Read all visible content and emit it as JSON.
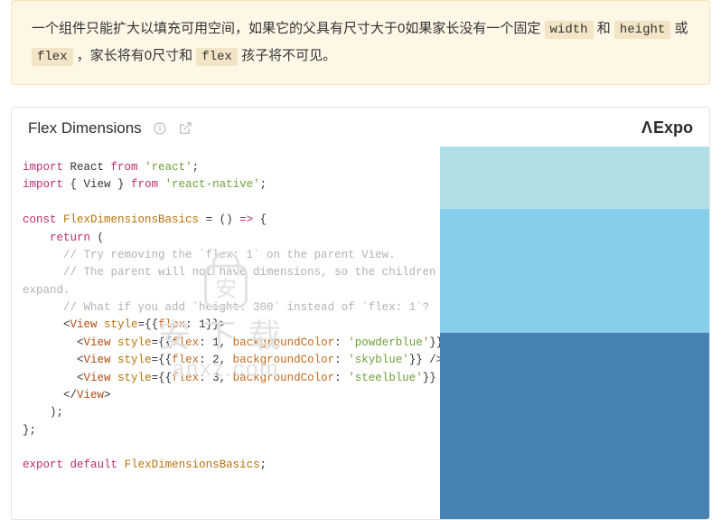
{
  "callout": {
    "seg1": "一个组件只能扩大以填充可用空间，如果它的父具有尺寸大于0如果家长没有一个固定 ",
    "code1": "width",
    "seg2": " 和 ",
    "code2": "height",
    "seg3": " 或 ",
    "code3": "flex",
    "seg4": " ，家长将有0尺寸和 ",
    "code4": "flex",
    "seg5": " 孩子将不可见。"
  },
  "panel": {
    "title": "Flex Dimensions",
    "brand": "Expo"
  },
  "code": {
    "lines": [
      {
        "t": "import",
        "kw": true
      },
      {
        "t": " React "
      },
      {
        "t": "from",
        "kw": true
      },
      {
        "t": " "
      },
      {
        "t": "'react'",
        "str": true
      },
      {
        "t": ";"
      },
      {
        "nl": true
      },
      {
        "t": "import",
        "kw": true
      },
      {
        "t": " { View } "
      },
      {
        "t": "from",
        "kw": true
      },
      {
        "t": " "
      },
      {
        "t": "'react-native'",
        "str": true
      },
      {
        "t": ";"
      },
      {
        "nl": true
      },
      {
        "nl": true
      },
      {
        "t": "const",
        "kw": true
      },
      {
        "t": " "
      },
      {
        "t": "FlexDimensionsBasics",
        "var": true
      },
      {
        "t": " = () "
      },
      {
        "t": "=>",
        "kw": true
      },
      {
        "t": " {"
      },
      {
        "nl": true
      },
      {
        "t": "    "
      },
      {
        "t": "return",
        "kw": true
      },
      {
        "t": " ("
      },
      {
        "nl": true
      },
      {
        "t": "      "
      },
      {
        "t": "// Try removing the `flex: 1` on the parent View.",
        "cmt": true
      },
      {
        "nl": true
      },
      {
        "t": "      "
      },
      {
        "t": "// The parent will not have dimensions, so the children can't",
        "cmt": true
      },
      {
        "nl": true
      },
      {
        "t": "expand.",
        "cmt": true
      },
      {
        "nl": true
      },
      {
        "t": "      "
      },
      {
        "t": "// What if you add `height: 300` instead of `flex: 1`?",
        "cmt": true
      },
      {
        "nl": true
      },
      {
        "t": "      <"
      },
      {
        "t": "View",
        "jsx": true
      },
      {
        "t": " "
      },
      {
        "t": "style",
        "attr": true
      },
      {
        "t": "="
      },
      {
        "t": "{{"
      },
      {
        "t": "flex",
        "prop": true
      },
      {
        "t": ": "
      },
      {
        "t": "1",
        "num": true
      },
      {
        "t": "}}"
      },
      {
        "t": ">"
      },
      {
        "nl": true
      },
      {
        "t": "        <"
      },
      {
        "t": "View",
        "jsx": true
      },
      {
        "t": " "
      },
      {
        "t": "style",
        "attr": true
      },
      {
        "t": "="
      },
      {
        "t": "{{"
      },
      {
        "t": "flex",
        "prop": true
      },
      {
        "t": ": "
      },
      {
        "t": "1",
        "num": true
      },
      {
        "t": ", "
      },
      {
        "t": "backgroundColor",
        "prop": true
      },
      {
        "t": ": "
      },
      {
        "t": "'powderblue'",
        "str": true
      },
      {
        "t": "}} />"
      },
      {
        "nl": true
      },
      {
        "t": "        <"
      },
      {
        "t": "View",
        "jsx": true
      },
      {
        "t": " "
      },
      {
        "t": "style",
        "attr": true
      },
      {
        "t": "="
      },
      {
        "t": "{{"
      },
      {
        "t": "flex",
        "prop": true
      },
      {
        "t": ": "
      },
      {
        "t": "2",
        "num": true
      },
      {
        "t": ", "
      },
      {
        "t": "backgroundColor",
        "prop": true
      },
      {
        "t": ": "
      },
      {
        "t": "'skyblue'",
        "str": true
      },
      {
        "t": "}} />"
      },
      {
        "nl": true
      },
      {
        "t": "        <"
      },
      {
        "t": "View",
        "jsx": true
      },
      {
        "t": " "
      },
      {
        "t": "style",
        "attr": true
      },
      {
        "t": "="
      },
      {
        "t": "{{"
      },
      {
        "t": "flex",
        "prop": true
      },
      {
        "t": ": "
      },
      {
        "t": "3",
        "num": true
      },
      {
        "t": ", "
      },
      {
        "t": "backgroundColor",
        "prop": true
      },
      {
        "t": ": "
      },
      {
        "t": "'steelblue'",
        "str": true
      },
      {
        "t": "}} />"
      },
      {
        "nl": true
      },
      {
        "t": "      </"
      },
      {
        "t": "View",
        "jsx": true
      },
      {
        "t": ">"
      },
      {
        "nl": true
      },
      {
        "t": "    );"
      },
      {
        "nl": true
      },
      {
        "t": "};"
      },
      {
        "nl": true
      },
      {
        "nl": true
      },
      {
        "t": "export",
        "kw": true
      },
      {
        "t": " "
      },
      {
        "t": "default",
        "kw": true
      },
      {
        "t": " "
      },
      {
        "t": "FlexDimensionsBasics",
        "var": true
      },
      {
        "t": ";"
      }
    ]
  },
  "preview": {
    "boxes": [
      "powderblue",
      "skyblue",
      "steelblue"
    ]
  },
  "watermark": {
    "zh": "安下载",
    "en": "anxz.com"
  }
}
